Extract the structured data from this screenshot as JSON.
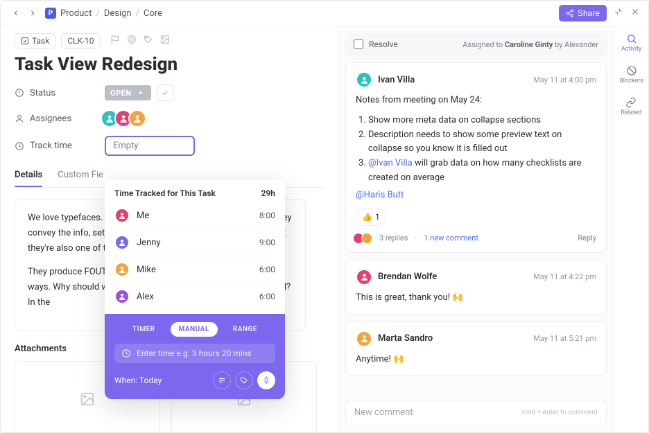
{
  "breadcrumb": {
    "space": "P",
    "items": [
      "Product",
      "Design",
      "Core"
    ]
  },
  "topbar": {
    "share": "Share"
  },
  "rail": {
    "activity": "Activity",
    "blockers": "Blockers",
    "related": "Related"
  },
  "task": {
    "type_label": "Task",
    "id": "CLK-10",
    "title": "Task View Redesign",
    "status_label": "Status",
    "status_value": "OPEN",
    "assignees_label": "Assignees",
    "track_label": "Track time",
    "track_value": "Empty"
  },
  "assignee_colors": [
    "#27c3c3",
    "#e83d6f",
    "#f2a33c"
  ],
  "tabs": {
    "details": "Details",
    "custom": "Custom Fie"
  },
  "desc": {
    "p1": "We love typefaces. They give our sites identity, look, and feel. They convey the info, set the tone, and build information hierarchy. But they're also one of the biggest factors that can make sites slow.",
    "p2": "They produce FOUT and FOIT, shift layout in some unpredictable ways. Why should we trade speed for design, or design for speed? In the"
  },
  "attach": {
    "title": "Attachments"
  },
  "timePopup": {
    "title": "Time Tracked for This Task",
    "total": "29h",
    "rows": [
      {
        "name": "Me",
        "time": "8:00",
        "color": "#e83d6f"
      },
      {
        "name": "Jenny",
        "time": "9:00",
        "color": "#7b68ee"
      },
      {
        "name": "Mike",
        "time": "6:00",
        "color": "#f2a33c"
      },
      {
        "name": "Alex",
        "time": "6:00",
        "color": "#9b51e0"
      }
    ],
    "modes": {
      "timer": "TIMER",
      "manual": "MANUAL",
      "range": "RANGE"
    },
    "placeholder": "Enter time e.g. 3 hours 20 mins",
    "when": "When: Today",
    "dollar": "$"
  },
  "activity": {
    "resolve": "Resolve",
    "assigned_prefix": "Assigned to ",
    "assigned_name": "Caroline Ginty",
    "assigned_by": " by Alexander",
    "reply": "Reply",
    "compose_placeholder": "New comment",
    "compose_hint": "cmd + enter to comment"
  },
  "c1": {
    "name": "Ivan Villa",
    "date": "May 11 at 4:00 pm",
    "intro": "Notes from meeting on May 24:",
    "li1": "Show more meta data on collapse sections",
    "li2": "Description needs to show some preview text on collapse so you know it is filled out",
    "li3a": "@Ivan Villa",
    "li3b": " will grab data on how many checklists are created on average",
    "mention": "@Haris Butt",
    "react_count": "1",
    "replies": "3 replies",
    "newc": "1 new comment"
  },
  "c2": {
    "name": "Brendan Wolfe",
    "date": "May 11 at 4:22 pm",
    "body": "This is great, thank you! 🙌"
  },
  "c3": {
    "name": "Marta Sandro",
    "date": "May 11 at 5:21 pm",
    "body": "Anytime! 🙌"
  }
}
